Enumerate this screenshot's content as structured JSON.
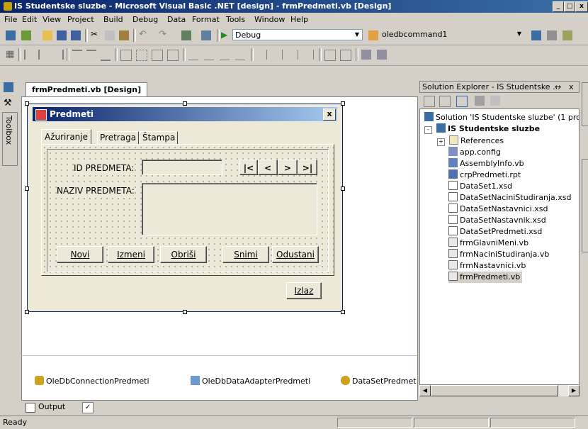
{
  "window": {
    "title": "IS Studentske sluzbe - Microsoft Visual Basic .NET [design] - frmPredmeti.vb [Design]",
    "min": "_",
    "restore": "□",
    "close": "x"
  },
  "menu": [
    "File",
    "Edit",
    "View",
    "Project",
    "Build",
    "Debug",
    "Data",
    "Format",
    "Tools",
    "Window",
    "Help"
  ],
  "toolbar": {
    "config": "Debug",
    "object": "oledbcommand1"
  },
  "leftbar": {
    "toolbox": "Toolbox"
  },
  "document": {
    "tab": "frmPredmeti.vb [Design]"
  },
  "form": {
    "title": "Predmeti",
    "close": "x",
    "tabs": [
      "Ažuriranje",
      "Pretraga",
      "Štampa"
    ],
    "id_label": "ID PREDMETA:",
    "naziv_label": "NAZIV PREDMETA:",
    "nav": [
      "|<",
      "<",
      ">",
      ">|"
    ],
    "buttons": [
      "Novi",
      "Izmeni",
      "Obriši",
      "Snimi",
      "Odustani"
    ],
    "izlaz": "Izlaz"
  },
  "tray": {
    "items": [
      "OleDbConnectionPredmeti",
      "OleDbDataAdapterPredmeti",
      "DataSetPredmet"
    ]
  },
  "solution_explorer": {
    "title": "Solution Explorer - IS Studentske ...",
    "pin": "↔",
    "close": "x",
    "solution": "Solution 'IS Studentske sluzbe' (1 proje",
    "project": "IS Studentske sluzbe",
    "items": [
      "References",
      "app.config",
      "AssemblyInfo.vb",
      "crpPredmeti.rpt",
      "DataSet1.xsd",
      "DataSetNaciniStudiranja.xsd",
      "DataSetNastavnici.xsd",
      "DataSetNastavnik.xsd",
      "DataSetPredmeti.xsd",
      "frmGlavniMeni.vb",
      "frmNaciniStudiranja.vb",
      "frmNastavnici.vb",
      "frmPredmeti.vb"
    ]
  },
  "output": {
    "label": "Output"
  },
  "status": {
    "text": "Ready"
  },
  "colors": {
    "titlebar": "#0a246a",
    "selection": "#316ac5"
  }
}
